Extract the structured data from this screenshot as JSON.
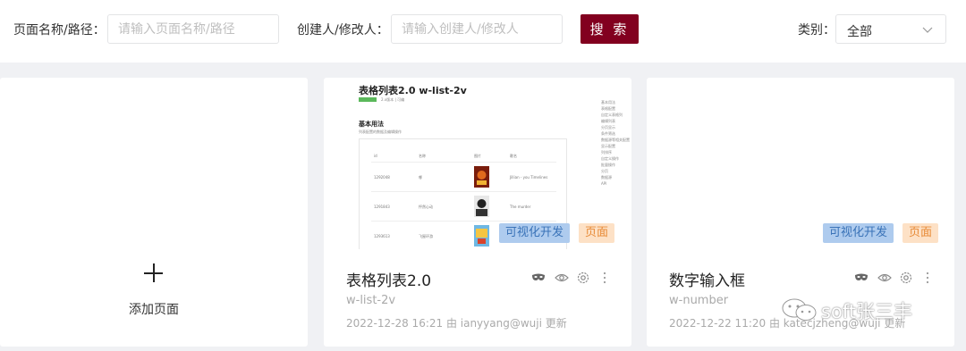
{
  "filters": {
    "page_label": "页面名称/路径：",
    "page_placeholder": "请输入页面名称/路径",
    "creator_label": "创建人/修改人：",
    "creator_placeholder": "请输入创建人/修改人",
    "search_label": "搜 索",
    "category_label": "类别：",
    "category_value": "全部"
  },
  "add_card": {
    "label": "添加页面"
  },
  "cards": [
    {
      "title": "表格列表2.0",
      "id": "w-list-2v",
      "meta": "2022-12-28 16:21 由 ianyyang@wuji 更新",
      "tags": [
        "可视化开发",
        "页面"
      ],
      "preview": {
        "heading": "表格列表2.0 w-list-2v",
        "section": "基本用法",
        "columns": [
          "id",
          "名称",
          "图片",
          "歌名"
        ],
        "rows": [
          {
            "id": "1292048",
            "name": "哪",
            "song": "Jillian - you Timelines"
          },
          {
            "id": "1291843",
            "name": "怦然心动",
            "song": "The murder"
          },
          {
            "id": "1293613",
            "name": "飞屋环游",
            "song": ""
          }
        ],
        "nav": [
          "基本用法",
          "表格配置",
          "自定义表格列",
          "编辑列表",
          "分页显示",
          "条件筛选",
          "数据源等相关配置",
          "显示配置",
          "列排序",
          "自定义操作",
          "批量操作",
          "分页",
          "数据源",
          "API"
        ]
      }
    },
    {
      "title": "数字输入框",
      "id": "w-number",
      "meta": "2022-12-22 11:20 由 katecjzheng@wuji 更新",
      "tags": [
        "可视化开发",
        "页面"
      ]
    }
  ],
  "watermark": "soft张三丰",
  "colors": {
    "primary": "#82001f",
    "tag_dev_bg": "#aecbee",
    "tag_page_bg": "#fde1c6"
  }
}
